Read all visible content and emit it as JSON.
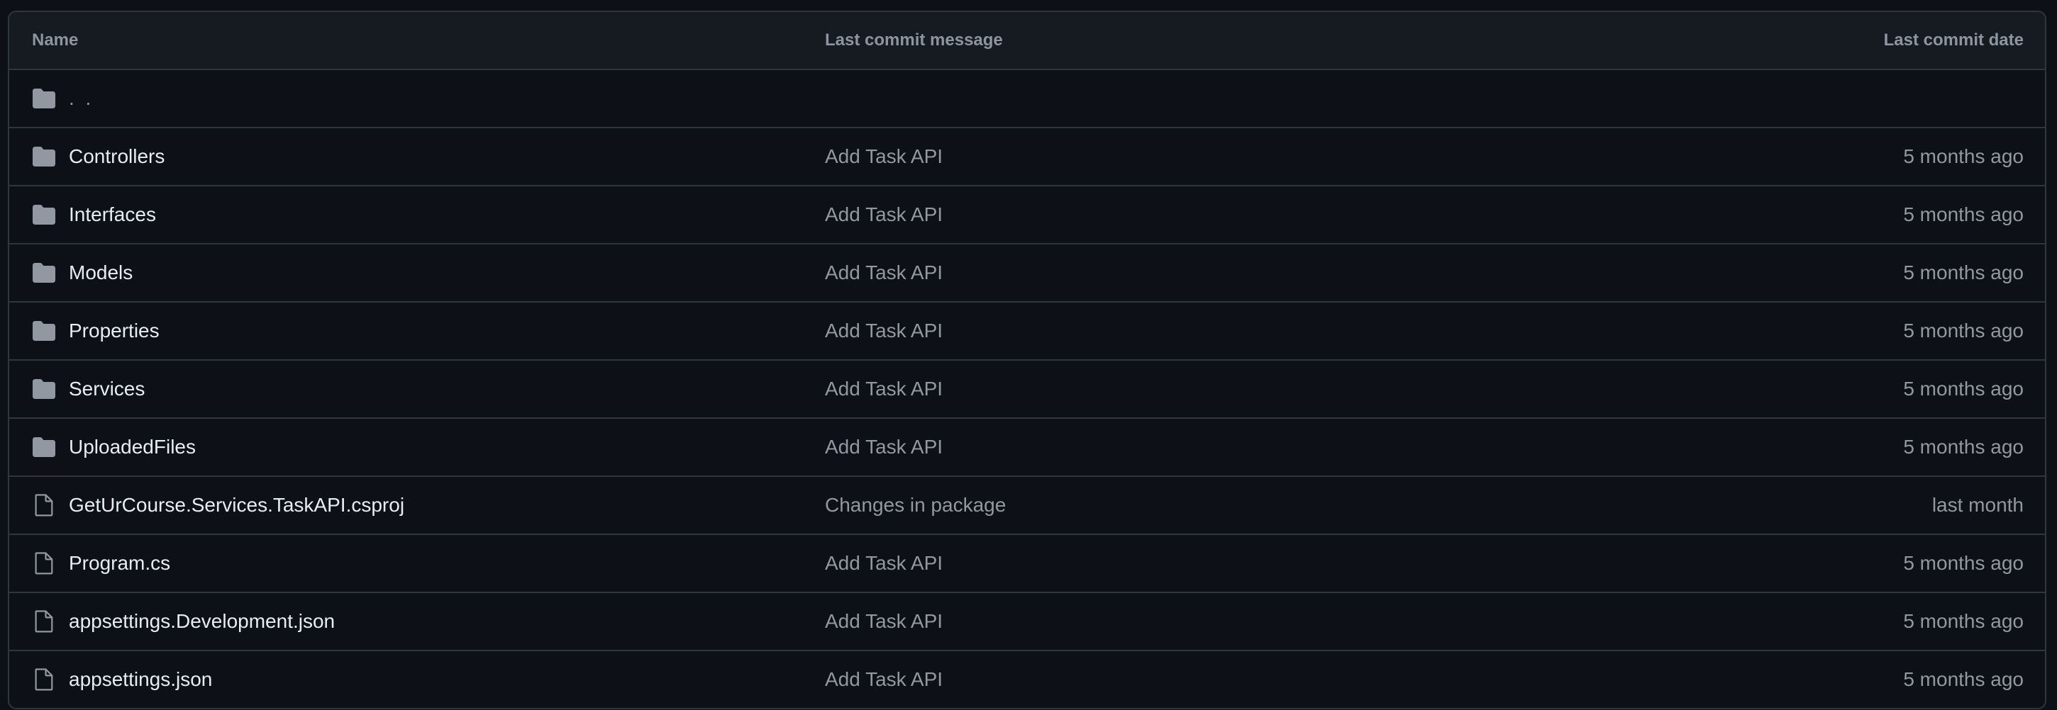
{
  "table": {
    "headers": {
      "name": "Name",
      "message": "Last commit message",
      "date": "Last commit date"
    },
    "parent": {
      "label": ". .",
      "icon": "folder-icon"
    },
    "rows": [
      {
        "name": "Controllers",
        "type": "folder",
        "icon": "folder-icon",
        "message": "Add Task API",
        "date": "5 months ago"
      },
      {
        "name": "Interfaces",
        "type": "folder",
        "icon": "folder-icon",
        "message": "Add Task API",
        "date": "5 months ago"
      },
      {
        "name": "Models",
        "type": "folder",
        "icon": "folder-icon",
        "message": "Add Task API",
        "date": "5 months ago"
      },
      {
        "name": "Properties",
        "type": "folder",
        "icon": "folder-icon",
        "message": "Add Task API",
        "date": "5 months ago"
      },
      {
        "name": "Services",
        "type": "folder",
        "icon": "folder-icon",
        "message": "Add Task API",
        "date": "5 months ago"
      },
      {
        "name": "UploadedFiles",
        "type": "folder",
        "icon": "folder-icon",
        "message": "Add Task API",
        "date": "5 months ago"
      },
      {
        "name": "GetUrCourse.Services.TaskAPI.csproj",
        "type": "file",
        "icon": "file-icon",
        "message": "Changes in package",
        "date": "last month"
      },
      {
        "name": "Program.cs",
        "type": "file",
        "icon": "file-icon",
        "message": "Add Task API",
        "date": "5 months ago"
      },
      {
        "name": "appsettings.Development.json",
        "type": "file",
        "icon": "file-icon",
        "message": "Add Task API",
        "date": "5 months ago"
      },
      {
        "name": "appsettings.json",
        "type": "file",
        "icon": "file-icon",
        "message": "Add Task API",
        "date": "5 months ago"
      }
    ]
  },
  "colors": {
    "background": "#0d1117",
    "header_background": "#161b22",
    "border": "#30363d",
    "primary_text": "#e6edf3",
    "muted_text": "#9198a1",
    "icon": "#9198a1"
  }
}
